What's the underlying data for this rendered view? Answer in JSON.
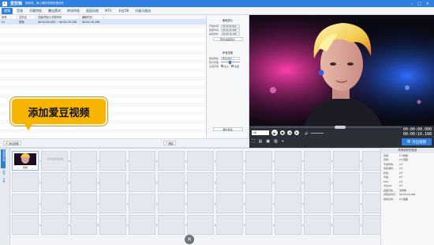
{
  "app": {
    "title": "爱剪辑",
    "subtitle": "超简单、最火爆的视频剪辑软件"
  },
  "tabs": [
    {
      "label": "视频",
      "active": true
    },
    {
      "label": "音频"
    },
    {
      "label": "字幕特效"
    },
    {
      "label": "叠加素材"
    },
    {
      "label": "转场特效"
    },
    {
      "label": "画面风格"
    },
    {
      "label": "MTV"
    },
    {
      "label": "卡拉OK"
    },
    {
      "label": "升级与服务"
    }
  ],
  "clip_list": {
    "headers": [
      "序号",
      "文件名",
      "在最终影片中的时间",
      "截取时长"
    ],
    "rows": [
      {
        "index": "01",
        "name": "视频",
        "range": "00:00:00.000 ~ 00:00:16.188",
        "duration": "00:00:16.188"
      }
    ]
  },
  "clip_panel": {
    "section_cut": "截取原片",
    "start_label": "开始时间",
    "start_value": "00:00:00.000",
    "end_label": "结束时间",
    "end_value": "00:00:16.188",
    "dur_label": "截取时长",
    "dur_value": "00:00:16.188",
    "precise_btn": "预览/截取原片",
    "section_audio": "声音设置",
    "track_label": "使用音轨",
    "track_value": "原片音轨1",
    "volume_label": "原片音量",
    "fade_label": "头尾声音",
    "fade_in": "淡入",
    "fade_out": "淡出",
    "confirm_btn": "确认修改"
  },
  "actions": {
    "add_video": "添加视频",
    "delete": "删除"
  },
  "player": {
    "time_current": "00:00:00.000",
    "time_total": "00:00:16.188",
    "export": "导出视频"
  },
  "timeline": {
    "side_tabs": [
      "已添加片段",
      "音频",
      "字幕"
    ],
    "first_clip_label": "视频",
    "slot_hint": "双击此处添加视频"
  },
  "info_panel": {
    "title": "所有制作的信息",
    "rows": [
      {
        "k": "视频:",
        "v": "1个视频"
      },
      {
        "k": "音频:",
        "v": "0个音频"
      },
      {
        "k": "字幕特效:",
        "v": "0个"
      },
      {
        "k": "叠加素材:",
        "v": "0个"
      },
      {
        "k": "转场:",
        "v": "0个"
      },
      {
        "k": "风格:",
        "v": "0个"
      },
      {
        "k": "MTV:",
        "v": "0个"
      },
      {
        "k": "卡拉OK:",
        "v": "0个"
      },
      {
        "k": "画面风格:",
        "v": "无特效"
      },
      {
        "k": "视频总时长:",
        "v": "00:00:16.188"
      },
      {
        "k": "视频总帧:",
        "v": "0个画面"
      }
    ]
  },
  "callout": {
    "text": "添加爱豆视频"
  },
  "colors": {
    "accent": "#2f7fe0",
    "callout": "#f7b500"
  }
}
